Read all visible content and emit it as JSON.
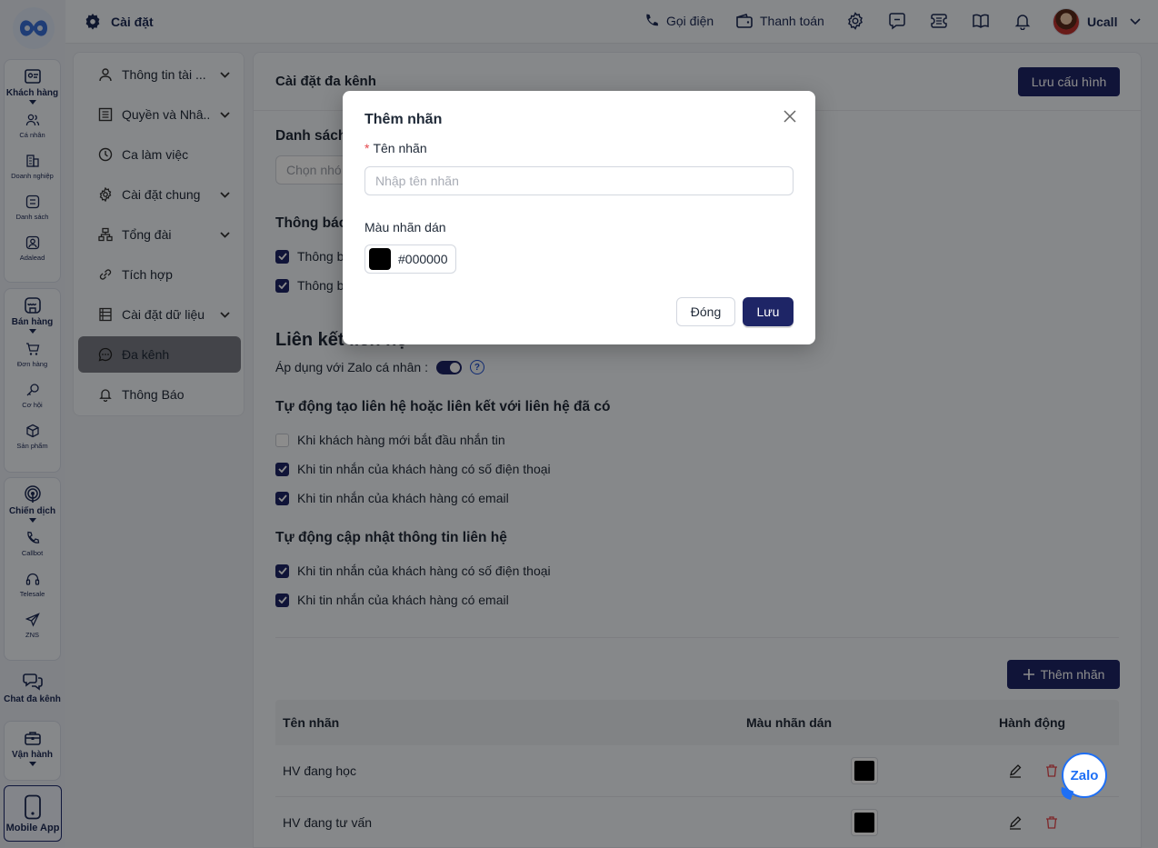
{
  "app": {
    "page_title": "Cài đặt",
    "user_name": "Ucall"
  },
  "topbar": {
    "call_label": "Gọi điện",
    "payment_label": "Thanh toán"
  },
  "rail": {
    "customers": "Khách hàng",
    "personal": "Cá nhân",
    "business": "Doanh nghiệp",
    "list": "Danh sách",
    "adalead": "Adalead",
    "sales": "Bán hàng",
    "orders": "Đơn hàng",
    "opportunities": "Cơ hội",
    "products": "Sản phẩm",
    "campaigns": "Chiến dịch",
    "callbot": "Callbot",
    "telesale": "Telesale",
    "zns": "ZNS",
    "omnichat": "Chat đa kênh",
    "operations": "Vận hành",
    "mobile_app": "Mobile App"
  },
  "menu": {
    "items": [
      {
        "label": "Thông tin tài ...",
        "icon": "user-icon",
        "has_children": true
      },
      {
        "label": "Quyền và Nhâ...",
        "icon": "list-icon",
        "has_children": true
      },
      {
        "label": "Ca làm việc",
        "icon": "clock-icon",
        "has_children": false
      },
      {
        "label": "Cài đặt chung",
        "icon": "gear-icon",
        "has_children": true
      },
      {
        "label": "Tổng đài",
        "icon": "network-icon",
        "has_children": true
      },
      {
        "label": "Tích hợp",
        "icon": "link-icon",
        "has_children": false
      },
      {
        "label": "Cài đặt dữ liệu",
        "icon": "database-icon",
        "has_children": true
      },
      {
        "label": "Đa kênh",
        "icon": "chat-icon",
        "has_children": false,
        "active": true
      },
      {
        "label": "Thông Báo",
        "icon": "bell-icon",
        "has_children": false
      }
    ]
  },
  "content": {
    "title": "Cài đặt đa kênh",
    "save_config": "Lưu cấu hình",
    "group_list_heading": "Danh sách",
    "group_select_placeholder": "Chọn nhó",
    "notify_heading": "Thông báo",
    "notify_options": [
      "Thông b",
      "Thông b"
    ],
    "link_heading": "Liên kết liên hệ",
    "zalo_personal_label": "Áp dụng với Zalo cá nhân :",
    "auto_create_heading": "Tự động tạo liên hệ hoặc liên kết với liên hệ đã có",
    "auto_create_options": [
      {
        "label": "Khi khách hàng mới bắt đầu nhắn tin",
        "checked": false
      },
      {
        "label": "Khi tin nhắn của khách hàng có số điện thoại",
        "checked": true
      },
      {
        "label": "Khi tin nhắn của khách hàng có email",
        "checked": true
      }
    ],
    "auto_update_heading": "Tự động cập nhật thông tin liên hệ",
    "auto_update_options": [
      {
        "label": "Khi tin nhắn của khách hàng có số điện thoại",
        "checked": true
      },
      {
        "label": "Khi tin nhắn của khách hàng có email",
        "checked": true
      }
    ],
    "add_tag_button": "Thêm nhãn",
    "table": {
      "headers": [
        "Tên nhãn",
        "Màu nhãn dán",
        "Hành động"
      ],
      "rows": [
        {
          "name": "HV đang học",
          "color": "#000000"
        },
        {
          "name": "HV đang tư vấn",
          "color": "#000000"
        }
      ]
    }
  },
  "modal": {
    "title": "Thêm nhãn",
    "name_label": "Tên nhãn",
    "name_placeholder": "Nhập tên nhãn",
    "color_label": "Màu nhãn dán",
    "color_value": "#000000",
    "close_button": "Đóng",
    "save_button": "Lưu"
  },
  "zalo_widget": "Zalo",
  "colors": {
    "primary": "#1e2566",
    "danger": "#e5484d",
    "zalo": "#1e6ff5"
  }
}
